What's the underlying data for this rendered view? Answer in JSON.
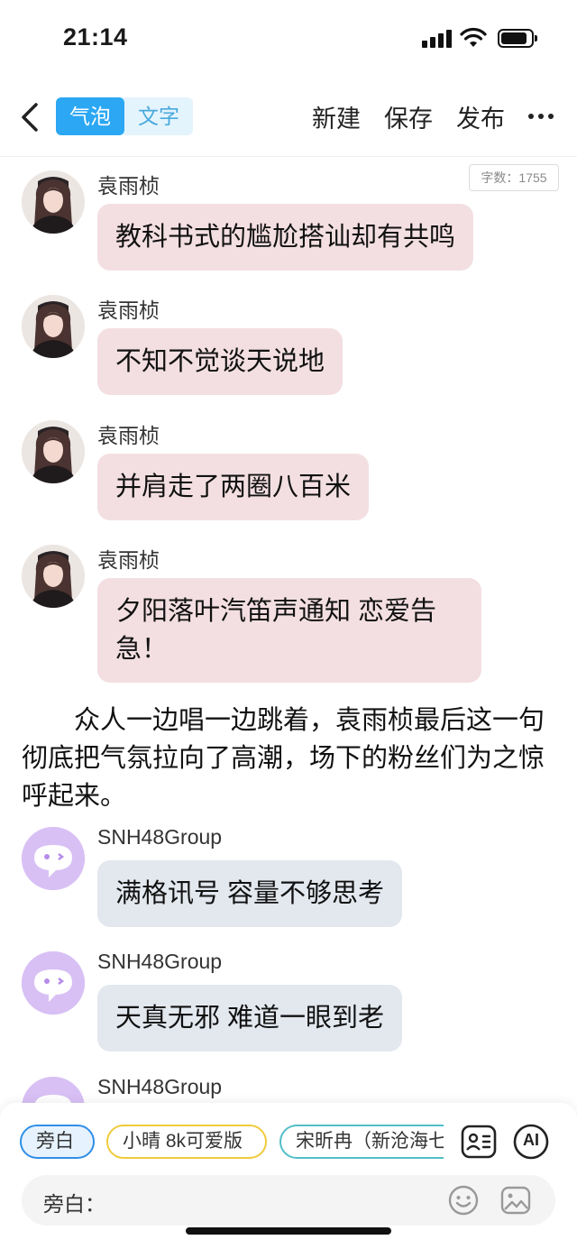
{
  "status_bar": {
    "time": "21:14"
  },
  "nav": {
    "mode_bubble": "气泡",
    "mode_text": "文字",
    "new": "新建",
    "save": "保存",
    "publish": "发布"
  },
  "word_count": "字数：1755",
  "messages": [
    {
      "sender": "袁雨桢",
      "text": "教科书式的尴尬搭讪却有共鸣",
      "avatar": "person-avatar"
    },
    {
      "sender": "袁雨桢",
      "text": "不知不觉谈天说地",
      "avatar": "person-avatar"
    },
    {
      "sender": "袁雨桢",
      "text": "并肩走了两圈八百米",
      "avatar": "person-avatar"
    },
    {
      "sender": "袁雨桢",
      "text": "夕阳落叶汽笛声通知 恋爱告急！",
      "avatar": "person-avatar"
    },
    {
      "sender": "SNH48Group",
      "text": "满格讯号 容量不够思考",
      "avatar": "chat-bubble-logo"
    },
    {
      "sender": "SNH48Group",
      "text": "天真无邪 难道一眼到老",
      "avatar": "chat-bubble-logo"
    },
    {
      "sender": "SNH48Group",
      "text": "",
      "avatar": "chat-bubble-logo"
    }
  ],
  "narration": "众人一边唱一边跳着，袁雨桢最后这一句彻底把气氛拉向了高潮，场下的粉丝们为之惊呼起来。",
  "characters": [
    {
      "label": "旁白",
      "color": "#2f8fe8"
    },
    {
      "label": "小晴 8k可爱版",
      "color": "#f0cb3c"
    },
    {
      "label": "宋昕冉（新沧海七",
      "color": "#51bec8"
    }
  ],
  "tools": {
    "ai_label": "AI"
  },
  "input": {
    "label": "旁白：",
    "value": ""
  },
  "colors": {
    "accent": "#2ba7f3",
    "bubble_pink": "#f3dfe2",
    "bubble_gray": "#e3e8ef",
    "bot_avatar": "#d8c0f5"
  }
}
